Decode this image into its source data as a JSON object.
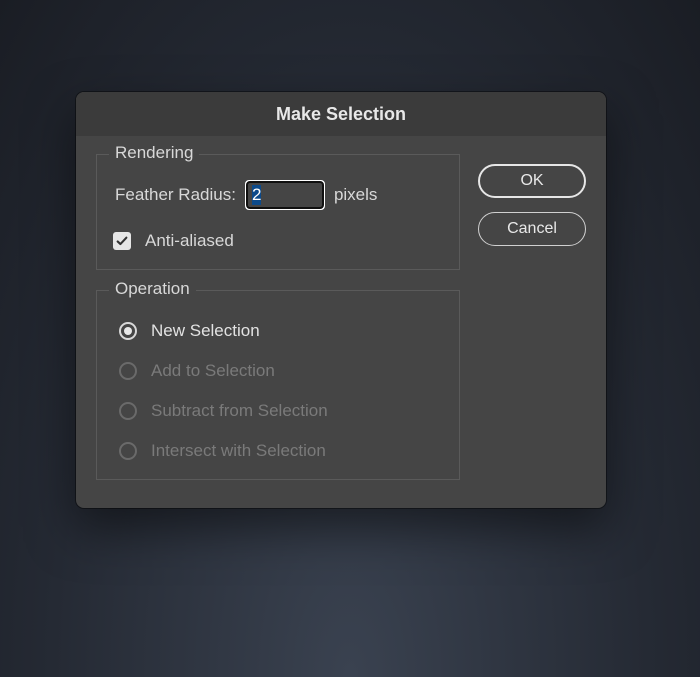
{
  "dialog": {
    "title": "Make Selection"
  },
  "rendering": {
    "legend": "Rendering",
    "featherLabel": "Feather Radius:",
    "featherValue": "2",
    "featherUnit": "pixels",
    "antiAliasedLabel": "Anti-aliased",
    "antiAliasedChecked": true
  },
  "operation": {
    "legend": "Operation",
    "options": [
      {
        "label": "New Selection",
        "selected": true,
        "enabled": true
      },
      {
        "label": "Add to Selection",
        "selected": false,
        "enabled": false
      },
      {
        "label": "Subtract from Selection",
        "selected": false,
        "enabled": false
      },
      {
        "label": "Intersect with Selection",
        "selected": false,
        "enabled": false
      }
    ]
  },
  "buttons": {
    "ok": "OK",
    "cancel": "Cancel"
  }
}
